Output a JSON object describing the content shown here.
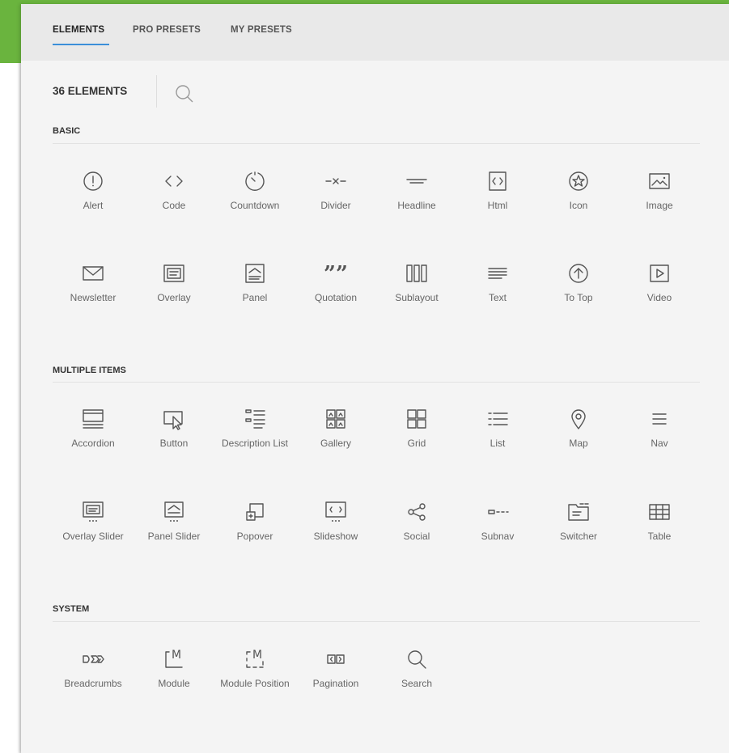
{
  "tabs": [
    "ELEMENTS",
    "PRO PRESETS",
    "MY PRESETS"
  ],
  "count_label": "36 ELEMENTS",
  "sections": [
    {
      "title": "BASIC",
      "items": [
        {
          "label": "Alert",
          "icon": "alert-icon"
        },
        {
          "label": "Code",
          "icon": "code-icon"
        },
        {
          "label": "Countdown",
          "icon": "countdown-icon"
        },
        {
          "label": "Divider",
          "icon": "divider-icon"
        },
        {
          "label": "Headline",
          "icon": "headline-icon"
        },
        {
          "label": "Html",
          "icon": "html-icon"
        },
        {
          "label": "Icon",
          "icon": "star-icon"
        },
        {
          "label": "Image",
          "icon": "image-icon"
        },
        {
          "label": "Newsletter",
          "icon": "newsletter-icon"
        },
        {
          "label": "Overlay",
          "icon": "overlay-icon"
        },
        {
          "label": "Panel",
          "icon": "panel-icon"
        },
        {
          "label": "Quotation",
          "icon": "quotation-icon"
        },
        {
          "label": "Sublayout",
          "icon": "sublayout-icon"
        },
        {
          "label": "Text",
          "icon": "text-icon"
        },
        {
          "label": "To Top",
          "icon": "totop-icon"
        },
        {
          "label": "Video",
          "icon": "video-icon"
        }
      ]
    },
    {
      "title": "MULTIPLE ITEMS",
      "items": [
        {
          "label": "Accordion",
          "icon": "accordion-icon"
        },
        {
          "label": "Button",
          "icon": "button-icon"
        },
        {
          "label": "Description List",
          "icon": "description-list-icon"
        },
        {
          "label": "Gallery",
          "icon": "gallery-icon"
        },
        {
          "label": "Grid",
          "icon": "grid-icon"
        },
        {
          "label": "List",
          "icon": "list-icon"
        },
        {
          "label": "Map",
          "icon": "map-icon"
        },
        {
          "label": "Nav",
          "icon": "nav-icon"
        },
        {
          "label": "Overlay Slider",
          "icon": "overlay-slider-icon"
        },
        {
          "label": "Panel Slider",
          "icon": "panel-slider-icon"
        },
        {
          "label": "Popover",
          "icon": "popover-icon"
        },
        {
          "label": "Slideshow",
          "icon": "slideshow-icon"
        },
        {
          "label": "Social",
          "icon": "social-icon"
        },
        {
          "label": "Subnav",
          "icon": "subnav-icon"
        },
        {
          "label": "Switcher",
          "icon": "switcher-icon"
        },
        {
          "label": "Table",
          "icon": "table-icon"
        }
      ]
    },
    {
      "title": "SYSTEM",
      "items": [
        {
          "label": "Breadcrumbs",
          "icon": "breadcrumbs-icon"
        },
        {
          "label": "Module",
          "icon": "module-icon"
        },
        {
          "label": "Module Position",
          "icon": "module-position-icon"
        },
        {
          "label": "Pagination",
          "icon": "pagination-icon"
        },
        {
          "label": "Search",
          "icon": "search-icon"
        }
      ]
    }
  ],
  "colors": {
    "accent": "#3c8fd9",
    "brand_green": "#6ab43e",
    "panel_bg": "#f4f4f4",
    "icon": "#555555"
  }
}
